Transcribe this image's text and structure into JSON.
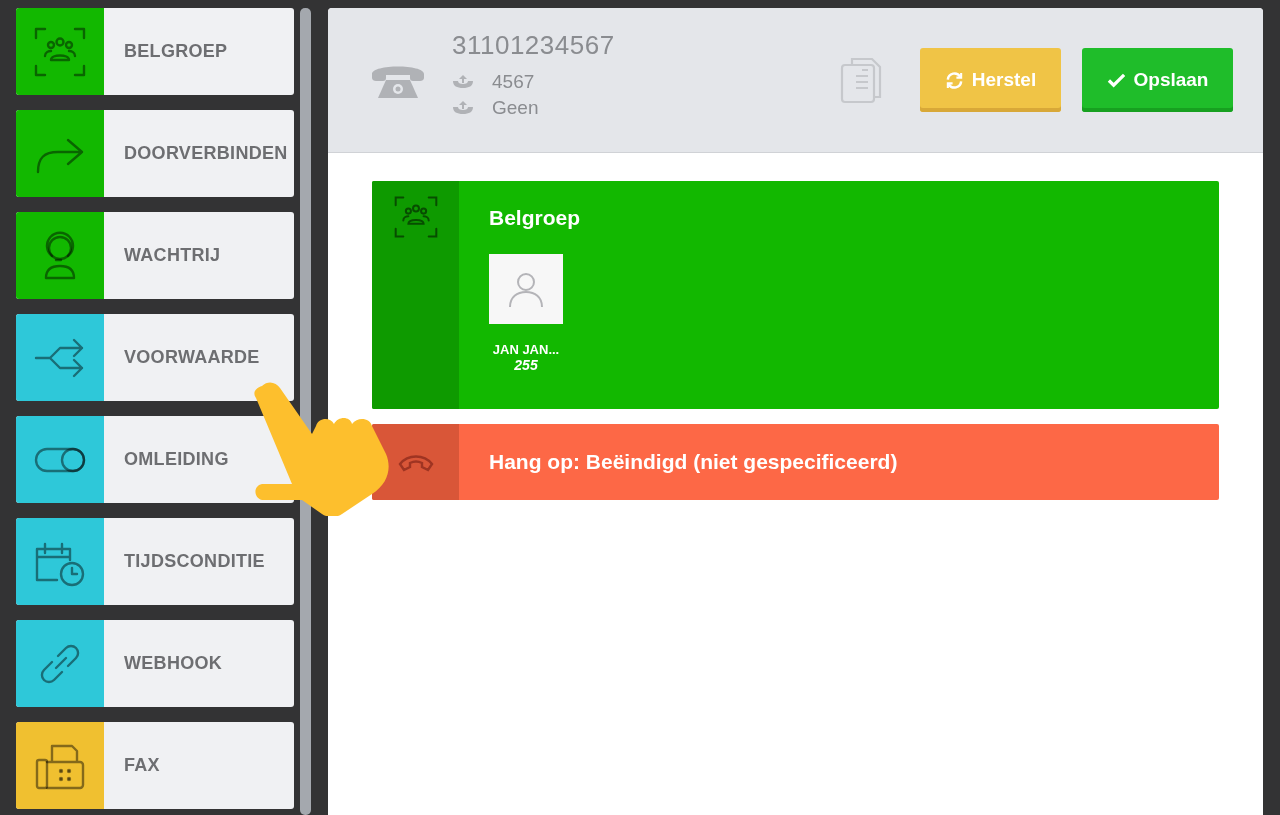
{
  "sidebar": {
    "items": [
      {
        "label": "BELGROEP",
        "color": "#12b800"
      },
      {
        "label": "DOORVERBINDEN",
        "color": "#12b800"
      },
      {
        "label": "WACHTRIJ",
        "color": "#12b800"
      },
      {
        "label": "VOORWAARDE",
        "color": "#2ec8d9"
      },
      {
        "label": "OMLEIDING",
        "color": "#2ec8d9"
      },
      {
        "label": "TIJDSCONDITIE",
        "color": "#2ec8d9"
      },
      {
        "label": "WEBHOOK",
        "color": "#2ec8d9"
      },
      {
        "label": "FAX",
        "color": "#f0c030"
      }
    ]
  },
  "header": {
    "number": "31101234567",
    "lines": [
      "4567",
      "Geen"
    ],
    "buttons": [
      {
        "kind": "reset",
        "label": "Herstel"
      },
      {
        "kind": "save",
        "label": "Opslaan"
      }
    ]
  },
  "flow": [
    {
      "kind": "group",
      "title": "Belgroep",
      "members": [
        {
          "name": "JAN JAN...",
          "extension": "255"
        }
      ]
    },
    {
      "kind": "hangup",
      "title": "Hang op: Beëindigd (niet gespecificeerd)"
    }
  ]
}
